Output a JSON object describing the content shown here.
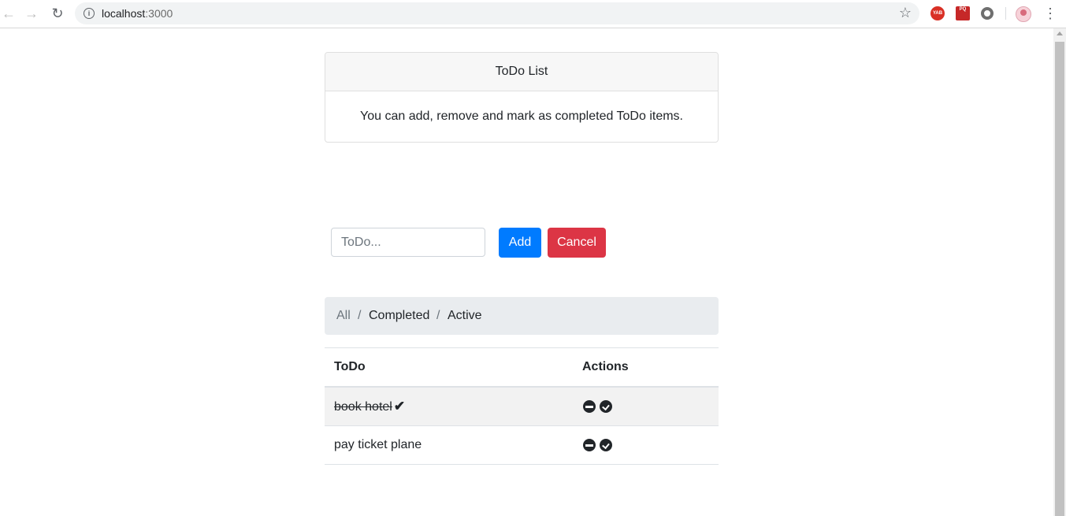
{
  "browser": {
    "url_host": "localhost",
    "url_port": ":3000",
    "extensions": {
      "yab": "YAB",
      "pq": "PQ"
    }
  },
  "card": {
    "title": "ToDo List",
    "description": "You can add, remove and mark as completed ToDo items."
  },
  "form": {
    "placeholder": "ToDo...",
    "add_label": "Add",
    "cancel_label": "Cancel"
  },
  "filters": {
    "all": "All",
    "separator": "/",
    "completed": "Completed",
    "active": "Active"
  },
  "table": {
    "headers": {
      "todo": "ToDo",
      "actions": "Actions"
    },
    "rows": [
      {
        "text": "book hotel",
        "completed": true
      },
      {
        "text": "pay ticket plane",
        "completed": false
      }
    ]
  },
  "colors": {
    "primary": "#007bff",
    "danger": "#dc3545",
    "breadcrumb_bg": "#e9ecef"
  },
  "icons": {
    "back": "arrow-left-icon",
    "forward": "arrow-right-icon",
    "reload": "reload-icon",
    "info": "info-icon",
    "bookmark": "star-icon",
    "menu": "more-vert-icon",
    "remove": "minus-circle-icon",
    "complete": "check-circle-icon",
    "done": "check-icon"
  }
}
